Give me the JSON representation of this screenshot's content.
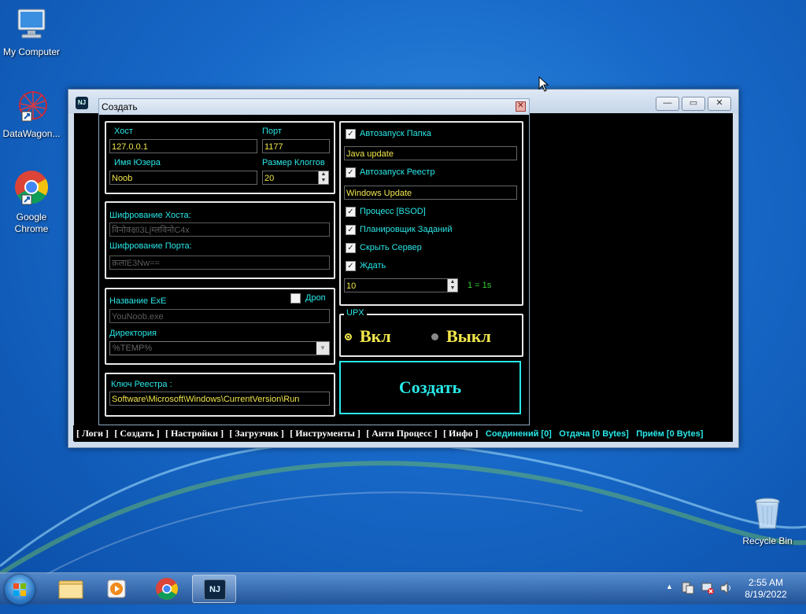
{
  "desktop": {
    "icons": [
      {
        "label": "My Computer"
      },
      {
        "label": "DataWagon..."
      },
      {
        "label": "Google Chrome"
      },
      {
        "label": "Recycle Bin"
      }
    ]
  },
  "app_window": {
    "logo_text": "NJ",
    "controls": {
      "minimize": "—",
      "restore": "▭",
      "close": "✕"
    }
  },
  "dialog": {
    "title": "Создать",
    "close": "✕",
    "host_group": {
      "host_label": "Хост",
      "host_value": "127.0.0.1",
      "port_label": "Порт",
      "port_value": "1177",
      "user_label": "Имя Юзера",
      "user_value": "Noob",
      "klog_label": "Размер Клоггов",
      "klog_value": "20"
    },
    "encryption_group": {
      "host_enc_label": "Шифрование Хоста:",
      "host_enc_value": "विनोक्क्षI3Lįम्लविनोC4x",
      "port_enc_label": "Шифрование Порта:",
      "port_enc_value": "क़लाE3Nw=="
    },
    "exe_group": {
      "exe_label": "Название ExE",
      "drop_label": "Дроп",
      "exe_value": "YouNoob.exe",
      "dir_label": "Директория",
      "dir_value": "%TEMP%"
    },
    "registry_group": {
      "key_label": "Ключ Реестра :",
      "key_value": "Software\\Microsoft\\Windows\\CurrentVersion\\Run"
    },
    "options_group": {
      "autorun_folder_label": "Автозапуск Папка",
      "autorun_folder_value": "Java update",
      "autorun_registry_label": "Автозапуск Реестр",
      "autorun_registry_value": "Windows Update",
      "bsod_label": "Процесс [BSOD]",
      "scheduler_label": "Планировщик Заданий",
      "hide_server_label": "Скрыть Сервер",
      "wait_label": "Ждать",
      "wait_value": "10",
      "wait_hint": "1 = 1s"
    },
    "upx_group": {
      "title": "UPX",
      "on_label": "Вкл",
      "off_label": "Выкл"
    },
    "create_button": "Создать"
  },
  "menubar": {
    "items": [
      "[ Логи ]",
      "[ Создать ]",
      "[ Настройки ]",
      "[ Загрузчик ]",
      "[ Инструменты ]",
      "[ Анти Процесс ]",
      "[ Инфо ]"
    ],
    "stats": [
      "Соединений [0]",
      "Отдача [0 Bytes]",
      "Приём [0 Bytes]"
    ]
  },
  "taskbar": {
    "time": "2:55 AM",
    "date": "8/19/2022",
    "active_app_text": "NJ"
  },
  "colors": {
    "cyan": "#29e8e8",
    "yellow": "#f2e84c",
    "green": "#36d236"
  }
}
